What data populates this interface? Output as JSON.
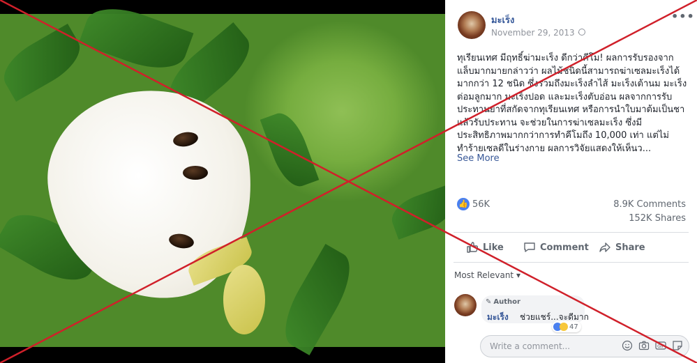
{
  "post": {
    "author": "มะเร็ง",
    "date": "November 29, 2013 ·",
    "more_icon": "more-options-icon",
    "body": "ทุเรียนเทศ มีฤทธิ์ฆ่ามะเร็ง ดีกว่าคีโม! ผลการรับรองจากแล็บมากมายกล่าวว่า ผลไม้ชนิดนี้สามารถฆ่าเซลมะเร็งได้มากกว่า 12 ชนิด ซึ่งรวมถึงมะเร็งลำไส้ มะเร็งเต้านม มะเร็งต่อมลูกมาก มะเร็งปอด และมะเร็งตับอ่อน ผลจากการรับประทานยาที่สกัดจากทุเรียนเทศ หรือการนำใบมาต้มเป็นชาแล้วรับประทาน จะช่วยในการฆ่าเซลมะเร็ง ซึ่งมีประสิทธิภาพมากกว่าการทำคีโมถึง 10,000 เท่า แต่ไม่ทำร้ายเซลดีในร่างกาย ผลการวิจัยแสดงให้เห็นว...",
    "see_more": "See More",
    "likes": "56K",
    "comments": "8.9K Comments",
    "shares": "152K Shares"
  },
  "actions": {
    "like": "Like",
    "comment": "Comment",
    "share": "Share"
  },
  "comments_section": {
    "sort": "Most Relevant ▾",
    "top_comment": {
      "badge": "Author",
      "author": "มะเร็ง",
      "text": "ช่วยแชร์...จะดีมาก",
      "reactions": "47"
    },
    "input_placeholder": "Write a comment..."
  },
  "colors": {
    "link": "#385898",
    "cross": "#d0202a",
    "like_blue": "#4a80ef"
  }
}
